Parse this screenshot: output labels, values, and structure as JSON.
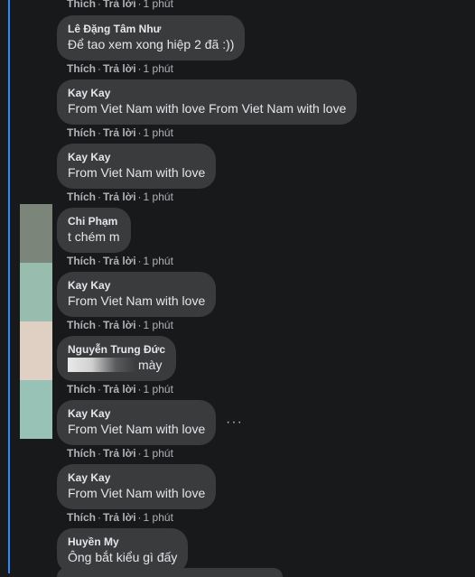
{
  "top_actions": {
    "like": "Thích",
    "reply": "Trả lời",
    "time": "1 phút"
  },
  "comments": [
    {
      "author": "Lê Đặng Tâm Như",
      "text": "Để tao xem xong hiệp 2 đã :))",
      "like": "Thích",
      "reply": "Trả lời",
      "time": "1 phút"
    },
    {
      "author": "Kay Kay",
      "text": "From Viet Nam with love From Viet Nam with love",
      "like": "Thích",
      "reply": "Trả lời",
      "time": "1 phút"
    },
    {
      "author": "Kay Kay",
      "text": "From Viet Nam with love",
      "like": "Thích",
      "reply": "Trả lời",
      "time": "1 phút"
    },
    {
      "author": "Chi Phạm",
      "text": "t chém m",
      "like": "Thích",
      "reply": "Trả lời",
      "time": "1 phút"
    },
    {
      "author": "Kay Kay",
      "text": "From Viet Nam with love",
      "like": "Thích",
      "reply": "Trả lời",
      "time": "1 phút"
    },
    {
      "author": "Nguyễn Trung Đức",
      "text": "mày",
      "like": "Thích",
      "reply": "Trả lời",
      "time": "1 phút"
    },
    {
      "author": "Kay Kay",
      "text": "From Viet Nam with love",
      "like": "Thích",
      "reply": "Trả lời",
      "time": "1 phút"
    },
    {
      "author": "Kay Kay",
      "text": "From Viet Nam with love",
      "like": "Thích",
      "reply": "Trả lời",
      "time": "1 phút"
    },
    {
      "author": "Huyền My",
      "text": "Ông bắt kiểu gì đấy"
    }
  ],
  "more_icon": "···",
  "colors": {
    "background": "#18191a",
    "bubble": "#3a3b3c",
    "accent_line": "#2d88ff",
    "meta_text": "#b0b3b8"
  }
}
